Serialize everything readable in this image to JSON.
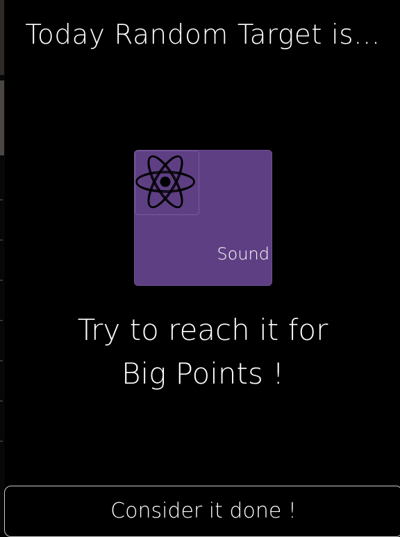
{
  "header": {
    "title": "Today Random Target is..."
  },
  "target_card": {
    "icon": "atom-icon",
    "label": "Sound",
    "background_color": "#5e3f83"
  },
  "message": {
    "line1": "Try to reach it for",
    "line2": "Big Points !"
  },
  "actions": {
    "confirm_label": "Consider it done !"
  }
}
